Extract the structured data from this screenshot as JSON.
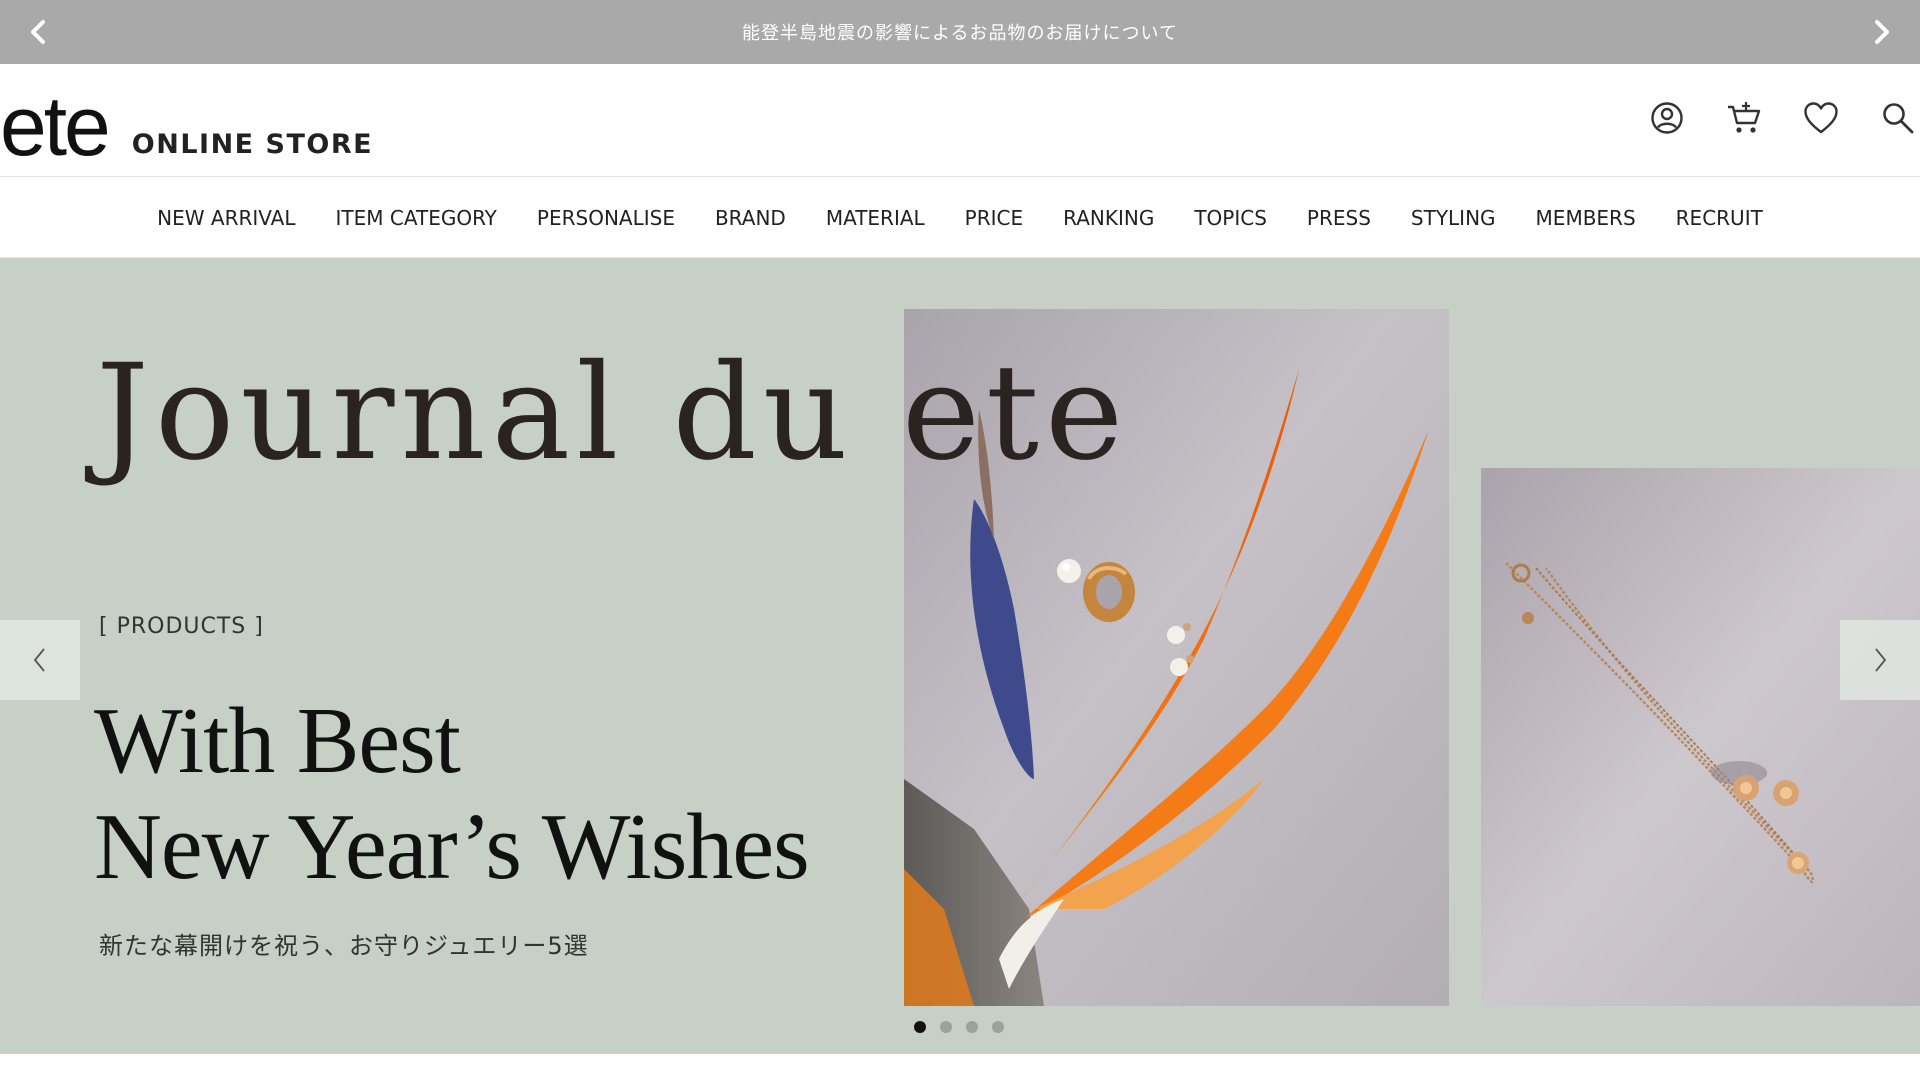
{
  "announcement": {
    "text": "能登半島地震の影響によるお品物のお届けについて",
    "prev_icon": "chevron-left-icon",
    "next_icon": "chevron-right-icon"
  },
  "header": {
    "logo_mark": "ete",
    "logo_sub": "ONLINE STORE",
    "icons": [
      "account-icon",
      "cart-icon",
      "heart-icon",
      "search-icon"
    ]
  },
  "nav": {
    "items": [
      {
        "label": "NEW ARRIVAL"
      },
      {
        "label": "ITEM CATEGORY"
      },
      {
        "label": "PERSONALISE"
      },
      {
        "label": "BRAND"
      },
      {
        "label": "MATERIAL"
      },
      {
        "label": "PRICE"
      },
      {
        "label": "RANKING"
      },
      {
        "label": "TOPICS"
      },
      {
        "label": "PRESS"
      },
      {
        "label": "STYLING"
      },
      {
        "label": "MEMBERS"
      },
      {
        "label": "RECRUIT"
      }
    ]
  },
  "hero": {
    "journal_title": "Journal du ete",
    "category": "[ PRODUCTS ]",
    "headline_line1": "With Best",
    "headline_line2": "New Year’s Wishes",
    "subtitle": "新たな幕開けを祝う、お守りジュエリー5選",
    "slide_count": 4,
    "active_slide": 1,
    "background_color": "#c6d0c6"
  }
}
